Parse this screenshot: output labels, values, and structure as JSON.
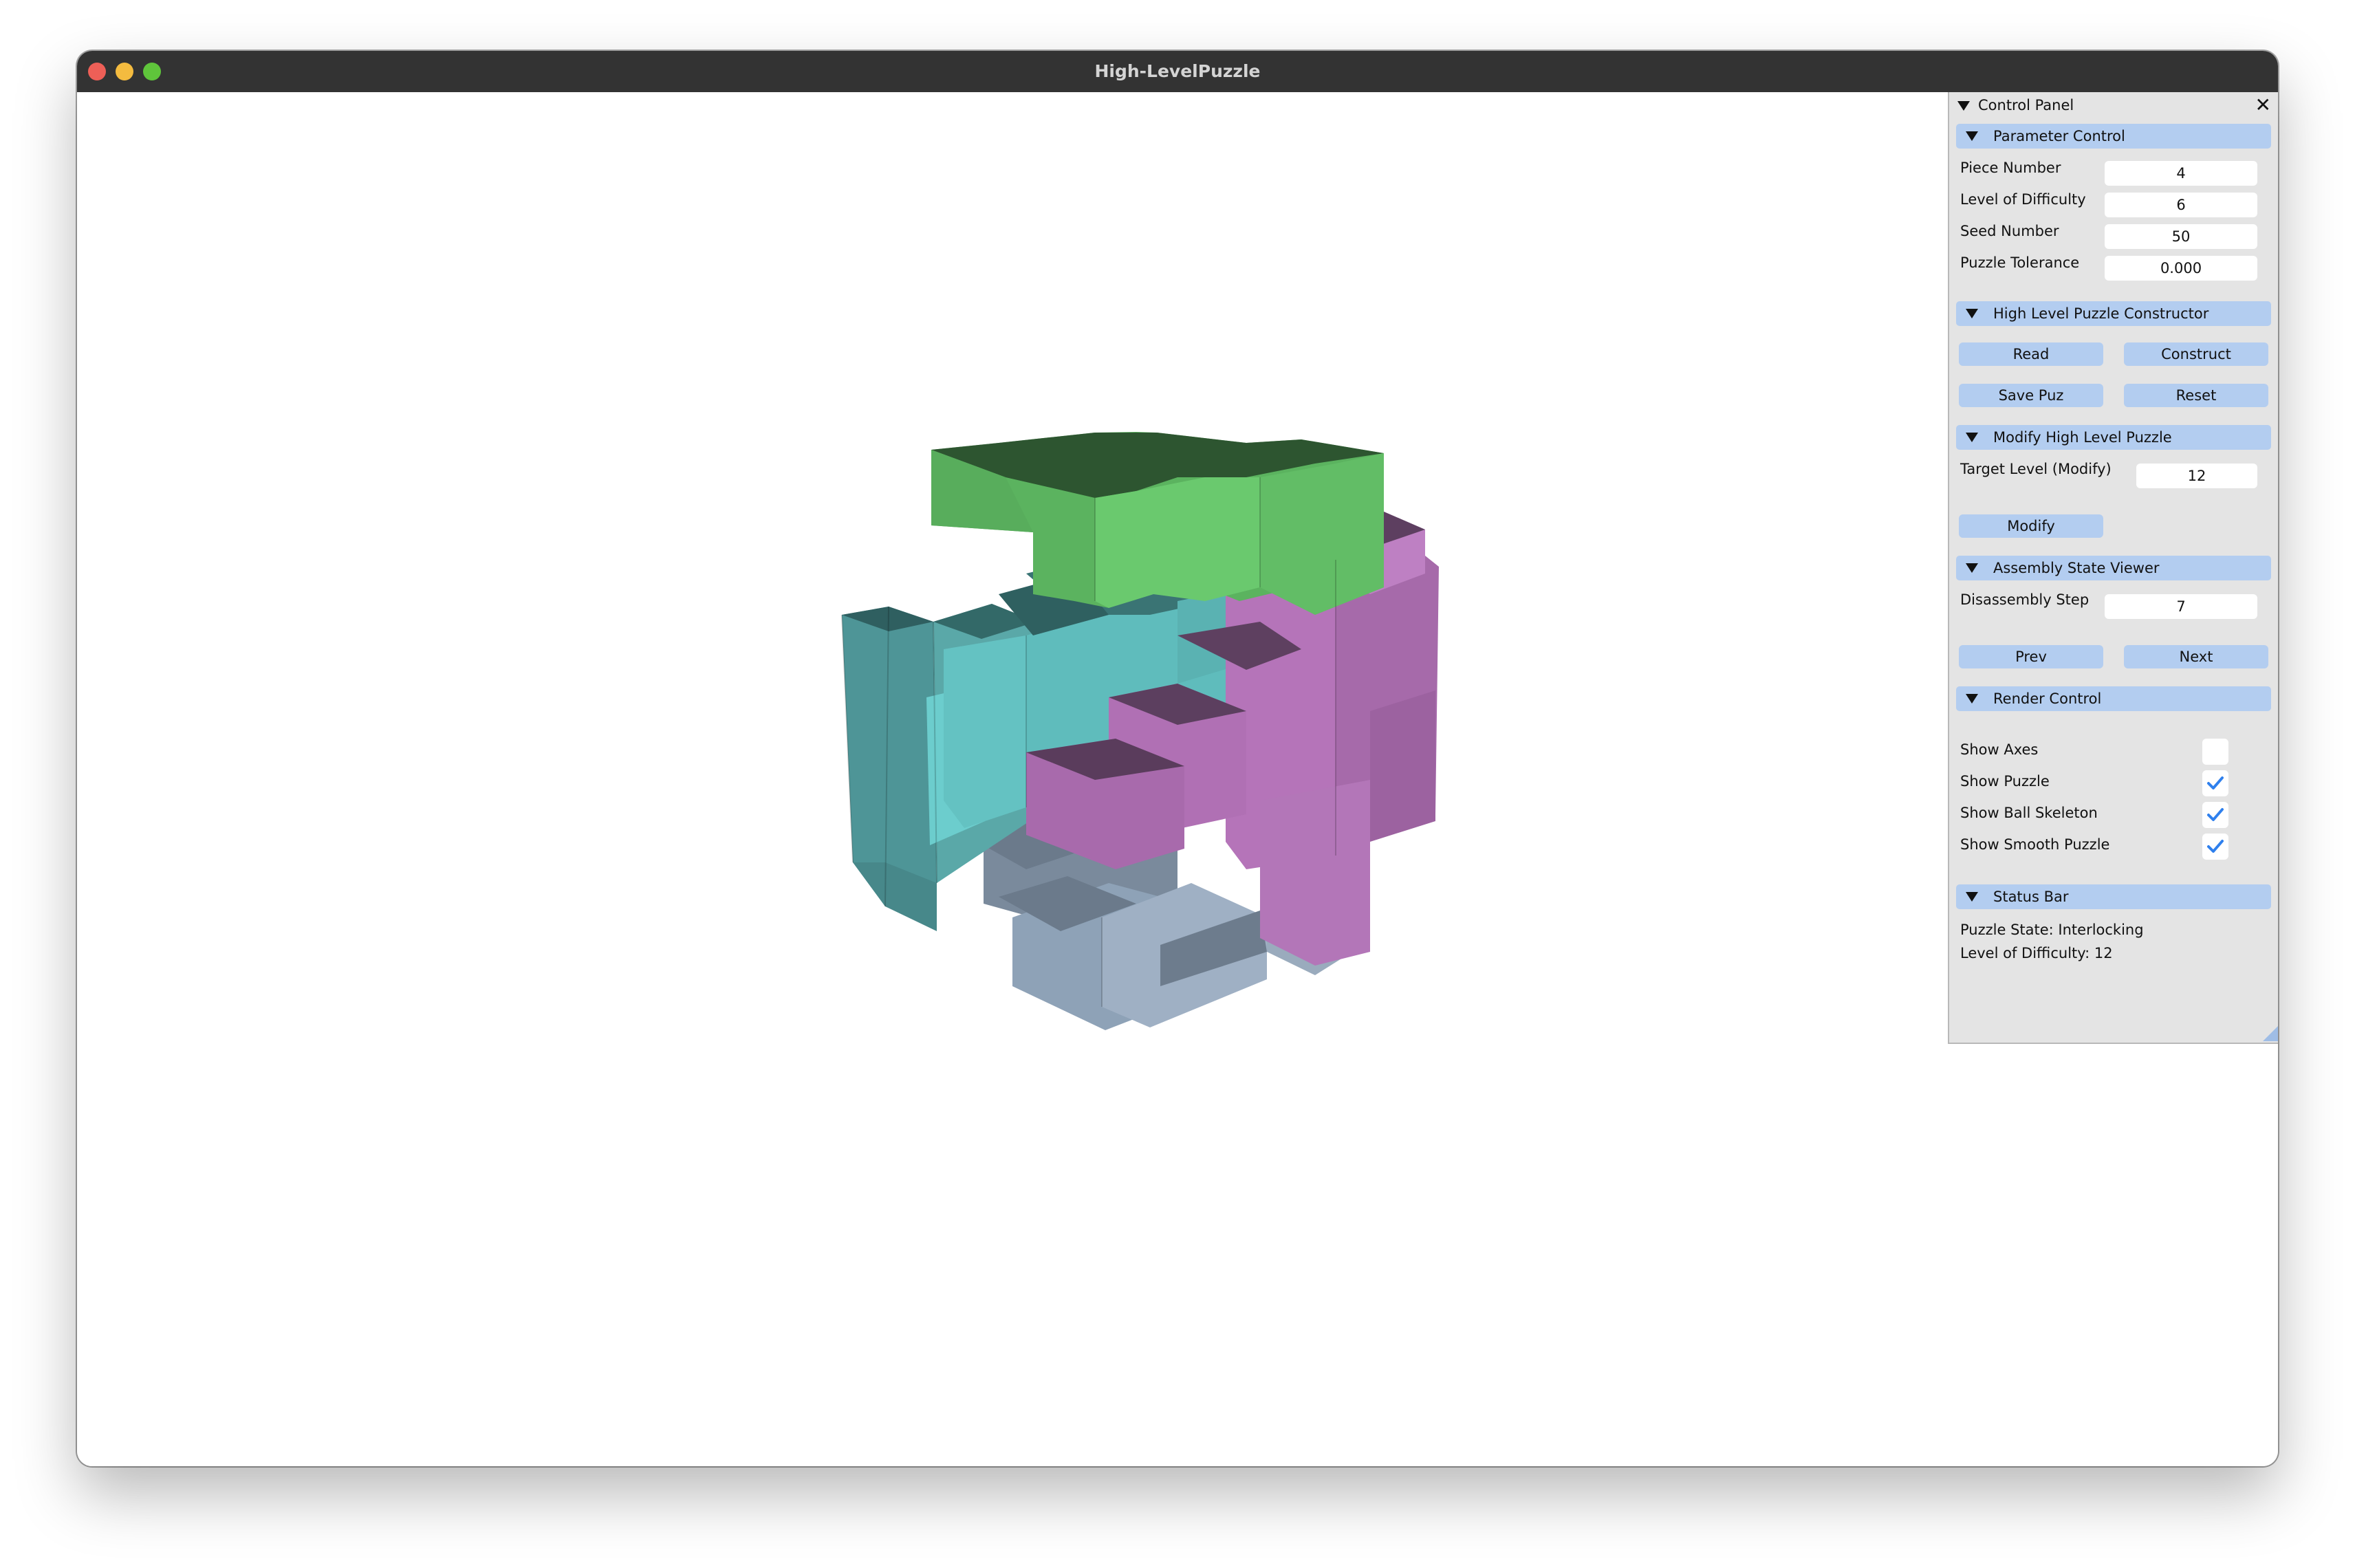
{
  "window": {
    "title": "High-LevelPuzzle"
  },
  "panel": {
    "title": "Control Panel",
    "close_glyph": "✕",
    "sections": {
      "parameter": {
        "title": "Parameter Control",
        "piece_number_label": "Piece Number",
        "piece_number_value": "4",
        "difficulty_label": "Level of Difficulty",
        "difficulty_value": "6",
        "seed_label": "Seed Number",
        "seed_value": "50",
        "tolerance_label": "Puzzle Tolerance",
        "tolerance_value": "0.000"
      },
      "constructor": {
        "title": "High Level Puzzle Constructor",
        "read_label": "Read",
        "construct_label": "Construct",
        "save_label": "Save Puz",
        "reset_label": "Reset"
      },
      "modify": {
        "title": "Modify High Level Puzzle",
        "target_label": "Target Level (Modify)",
        "target_value": "12",
        "modify_label": "Modify"
      },
      "assembly": {
        "title": "Assembly State Viewer",
        "step_label": "Disassembly Step",
        "step_value": "7",
        "prev_label": "Prev",
        "next_label": "Next"
      },
      "render": {
        "title": "Render Control",
        "show_axes_label": "Show Axes",
        "show_axes_checked": false,
        "show_puzzle_label": "Show Puzzle",
        "show_puzzle_checked": true,
        "show_skeleton_label": "Show Ball Skeleton",
        "show_skeleton_checked": true,
        "show_smooth_label": "Show Smooth Puzzle",
        "show_smooth_checked": true
      },
      "status": {
        "title": "Status Bar",
        "state_line": "Puzzle State: Interlocking",
        "level_line": "Level of Difficulty: 12"
      }
    }
  },
  "colors": {
    "titlebar": "#333333",
    "section_header": "#b3cdf0",
    "piece_green": "#66c36a",
    "piece_teal": "#4f9a9a",
    "piece_cyan": "#66c8c8",
    "piece_purple": "#b373b7",
    "piece_gray": "#8d9fb2",
    "check_blue": "#2f80ed"
  }
}
